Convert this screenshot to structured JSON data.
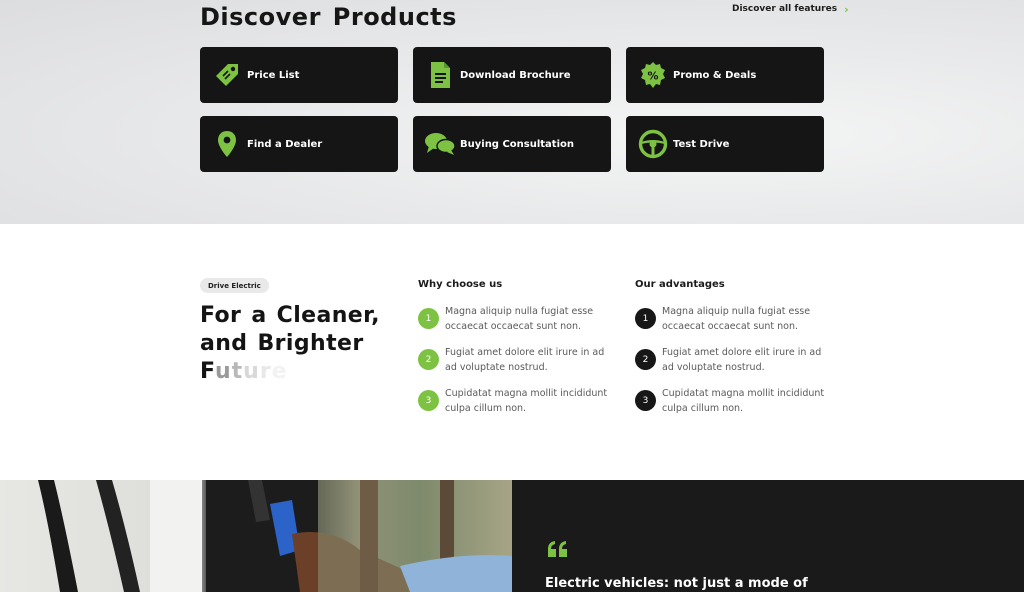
{
  "discover": {
    "title": "Discover Products",
    "all_features_link": "Discover all features",
    "cards": [
      {
        "label": "Price List",
        "icon": "price-tag-icon"
      },
      {
        "label": "Download Brochure",
        "icon": "document-icon"
      },
      {
        "label": "Promo & Deals",
        "icon": "percent-badge-icon"
      },
      {
        "label": "Find a Dealer",
        "icon": "map-pin-icon"
      },
      {
        "label": "Buying Consultation",
        "icon": "chat-bubbles-icon"
      },
      {
        "label": "Test Drive",
        "icon": "steering-wheel-icon"
      }
    ]
  },
  "electric": {
    "badge": "Drive Electric",
    "headline_line1": "For a Cleaner,",
    "headline_line2": "and Brighter",
    "headline_line3": "Future",
    "why_title": "Why choose us",
    "advantages_title": "Our advantages",
    "why_items": [
      {
        "num": "1",
        "text": "Magna aliquip nulla fugiat esse occaecat occaecat sunt non."
      },
      {
        "num": "2",
        "text": "Fugiat amet dolore elit irure in ad ad voluptate nostrud."
      },
      {
        "num": "3",
        "text": "Cupidatat magna mollit incididunt culpa cillum non."
      }
    ],
    "advantage_items": [
      {
        "num": "1",
        "text": "Magna aliquip nulla fugiat esse occaecat occaecat sunt non."
      },
      {
        "num": "2",
        "text": "Fugiat amet dolore elit irure in ad ad voluptate nostrud."
      },
      {
        "num": "3",
        "text": "Cupidatat magna mollit incididunt culpa cillum non."
      }
    ]
  },
  "testimonial": {
    "quote_text": "Electric vehicles: not just a mode of",
    "quote_icon": "quote-mark-icon"
  },
  "colors": {
    "accent": "#7dc243",
    "card_bg": "#151515",
    "dark_panel": "#1a1a1a"
  }
}
